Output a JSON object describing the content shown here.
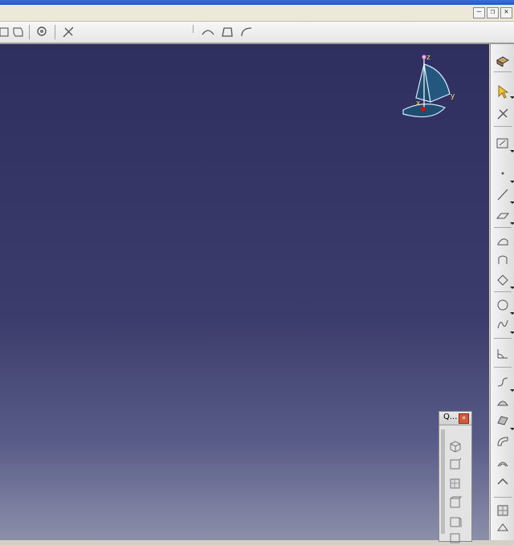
{
  "window": {
    "controls": {
      "minimize": "–",
      "restore": "❐",
      "close": "✕"
    }
  },
  "top_toolbar": {
    "icons": [
      "view-icon",
      "part-icon",
      "gear-assembly-icon",
      "analysis-icon",
      "sweep-icon",
      "surface-icon",
      "blend-icon"
    ]
  },
  "compass": {
    "x_label": "x",
    "y_label": "y",
    "z_label": "z"
  },
  "right_toolbar": {
    "icons": [
      "sketch-icon",
      "select-arrow-icon",
      "tools-icon",
      "sketch-plane-icon",
      "point-icon",
      "line-icon",
      "plane-icon",
      "extrude-icon",
      "revolve-icon",
      "sweep-icon",
      "circle-icon",
      "spline-icon",
      "corner-icon",
      "connect-icon",
      "fill-icon",
      "multi-section-icon",
      "blend-icon",
      "offset-icon",
      "join-icon",
      "boundary-icon",
      "extract-icon",
      "split-icon"
    ]
  },
  "quick_view_panel": {
    "title": "Q...",
    "close_symbol": "×",
    "icons": [
      "iso-view-icon",
      "front-view-icon",
      "back-view-icon",
      "left-view-icon",
      "right-view-icon",
      "top-view-icon"
    ]
  },
  "colors": {
    "viewport_top": "#2f2f5f",
    "viewport_bottom": "#8c8faa",
    "compass_fill": "#1f4d70",
    "compass_stroke": "#cfe6ff",
    "axis_origin": "#cc1111"
  }
}
